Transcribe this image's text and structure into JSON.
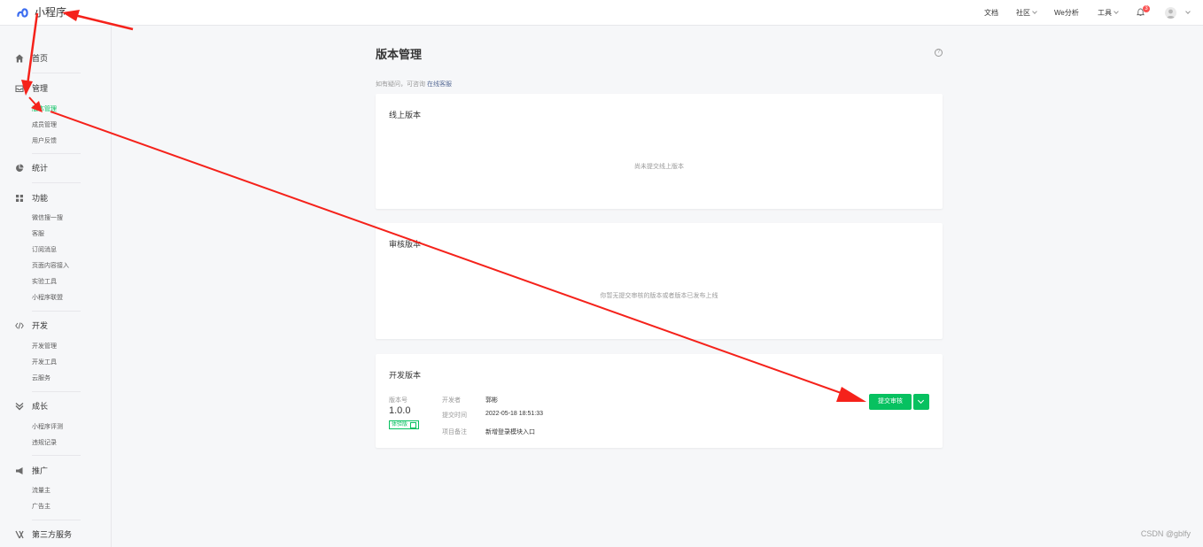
{
  "topbar": {
    "app_name": "小程序",
    "docs": "文档",
    "community": "社区",
    "we_analytics": "We分析",
    "tools": "工具",
    "notification_count": "3"
  },
  "sidebar": {
    "home": "首页",
    "manage": "管理",
    "manage_items": [
      "版本管理",
      "成员管理",
      "用户反馈"
    ],
    "stats": "统计",
    "features": "功能",
    "feature_items": [
      "微信搜一搜",
      "客服",
      "订阅消息",
      "页面内容接入",
      "实验工具",
      "小程序联盟"
    ],
    "dev": "开发",
    "dev_items": [
      "开发管理",
      "开发工具",
      "云服务"
    ],
    "growth": "成长",
    "growth_items": [
      "小程序评测",
      "违规记录"
    ],
    "promo": "推广",
    "promo_items": [
      "流量主",
      "广告主"
    ],
    "third_party": "第三方服务"
  },
  "main": {
    "title": "版本管理",
    "hint_text": "如有疑问，可咨询",
    "hint_link": "在线客服",
    "online": {
      "title": "线上版本",
      "empty": "尚未提交线上版本"
    },
    "review": {
      "title": "审核版本",
      "empty": "你暂无提交审核的版本或者版本已发布上线"
    },
    "dev_version": {
      "title": "开发版本",
      "version_label": "版本号",
      "version": "1.0.0",
      "badge": "体验版",
      "developer_label": "开发者",
      "developer": "郭彬",
      "submit_time_label": "提交时间",
      "submit_time": "2022-05-18 18:51:33",
      "remark_label": "项目备注",
      "remark": "新增登录模块入口",
      "submit_button": "提交审核"
    }
  },
  "watermark": "CSDN @gblfy",
  "colors": {
    "primary": "#07c160",
    "link": "#576b95",
    "badge": "#fa5151",
    "annotation_arrow": "#f5221b"
  }
}
